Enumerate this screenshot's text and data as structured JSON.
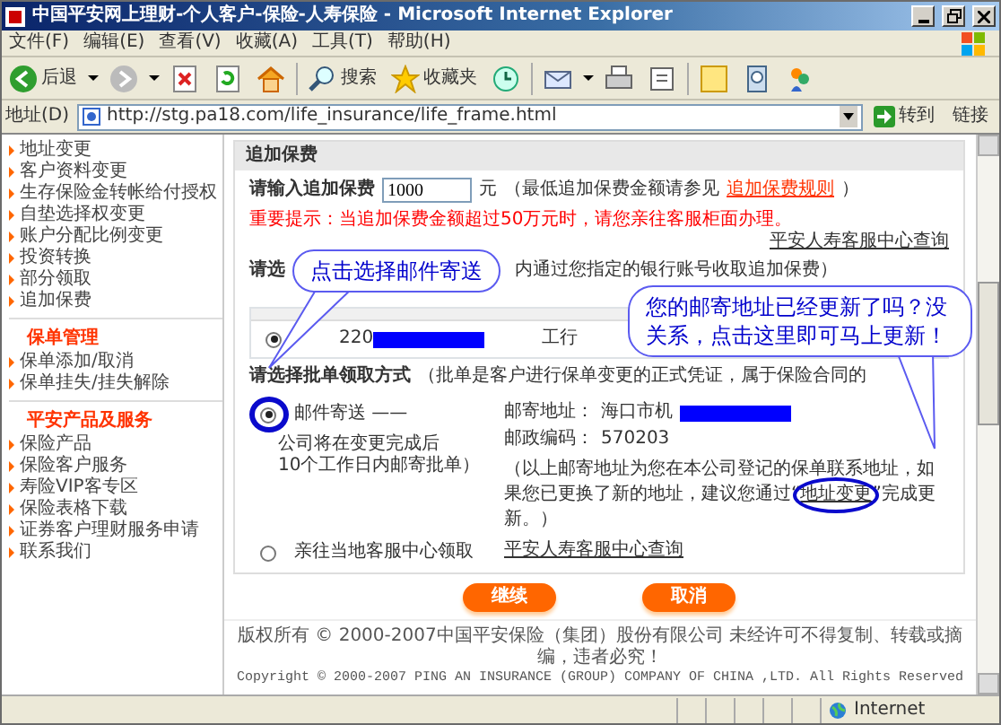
{
  "window": {
    "title": "中国平安网上理财-个人客户-保险-人寿保险 - Microsoft Internet Explorer"
  },
  "menu": [
    "文件(F)",
    "编辑(E)",
    "查看(V)",
    "收藏(A)",
    "工具(T)",
    "帮助(H)"
  ],
  "toolbar": [
    {
      "kind": "back",
      "label": "后退"
    },
    {
      "kind": "forward"
    },
    {
      "kind": "stop"
    },
    {
      "kind": "refresh"
    },
    {
      "kind": "home"
    },
    {
      "kind": "search",
      "label": "搜索"
    },
    {
      "kind": "favorites",
      "label": "收藏夹"
    },
    {
      "kind": "history"
    },
    {
      "kind": "mail"
    },
    {
      "kind": "print"
    },
    {
      "kind": "edit"
    },
    {
      "kind": "note"
    },
    {
      "kind": "research"
    },
    {
      "kind": "messenger"
    }
  ],
  "address": {
    "label": "地址(D)",
    "url": "http://stg.pa18.com/life_insurance/life_frame.html",
    "go": "转到",
    "links": "链接"
  },
  "sidebar": {
    "sections": [
      {
        "items": [
          "地址变更",
          "客户资料变更",
          "生存保险金转帐给付授权",
          "自垫选择权变更",
          "账户分配比例变更",
          "投资转换",
          "部分领取",
          "追加保费"
        ]
      },
      {
        "title": "保单管理",
        "items": [
          "保单添加/取消",
          "保单挂失/挂失解除"
        ]
      },
      {
        "title": "平安产品及服务",
        "items": [
          "保险产品",
          "保险客户服务",
          "寿险VIP客专区",
          "保险表格下载",
          "证券客户理财服务申请",
          "联系我们"
        ]
      }
    ]
  },
  "form": {
    "header": "追加保费",
    "amount_label": "请输入追加保费",
    "amount_value": "1000",
    "unit": "元",
    "hint_before": "（最低追加保费金额请参见",
    "hint_link": "追加保费规则",
    "hint_after": "）",
    "notice": "重要提示：当追加保费金额超过50万元时，请您亲往客服柜面办理。",
    "notice_link": "平安人寿客服中心查询",
    "account_prompt_start": "请选",
    "account_prompt_end": "内通过您指定的银行账号收取追加保费）",
    "accounts": [
      {
        "selected": true,
        "number": "220",
        "bank": "工行"
      }
    ],
    "delivery_prompt": "请选择批单领取方式",
    "delivery_note": "（批单是客户进行保单变更的正式凭证，属于保险合同的",
    "delivery_options": [
      {
        "kind": "mail",
        "selected": true,
        "label": "邮件寄送 ——",
        "note_lines": [
          "公司将在变更完成后",
          "10个工作日内邮寄批单）"
        ],
        "address_label": "邮寄地址：",
        "address": "海口市机",
        "postcode_label": "邮政编码：",
        "postcode": "570203",
        "info_before": "（以上邮寄地址为您在本公司登记的保单联系地址，如果您已更换了新的地址，建议您通过“",
        "info_link": "地址变更",
        "info_after": "”完成更新。）"
      },
      {
        "kind": "counter",
        "selected": false,
        "label": "亲往当地客服中心领取",
        "link": "平安人寿客服中心查询"
      }
    ]
  },
  "buttons": [
    "继续",
    "取消"
  ],
  "callouts": [
    {
      "text": "点击选择邮件寄送"
    },
    {
      "text": "您的邮寄地址已经更新了吗？没关系，点击这里即可马上更新！"
    }
  ],
  "footer": {
    "lines": [
      "版权所有 © 2000-2007中国平安保险（集团）股份有限公司 未经许可不得复制、转载或摘编，违者必究！",
      "Copyright © 2000-2007 PING AN INSURANCE (GROUP) COMPANY OF CHINA ,LTD. All Rights Reserved"
    ]
  },
  "status_bar": {
    "zone": "Internet"
  }
}
